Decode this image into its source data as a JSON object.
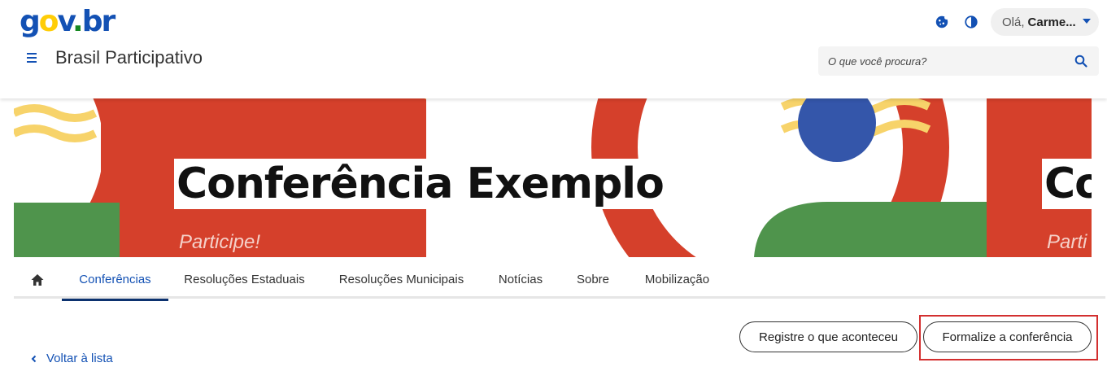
{
  "header": {
    "logo": {
      "g": "g",
      "o": "o",
      "v": "v",
      "dot": ".",
      "br": "br"
    },
    "cookie_icon": "cookie-icon",
    "contrast_icon": "contrast-icon",
    "user": {
      "greeting": "Olá,",
      "name": "Carme..."
    },
    "menu_icon": "hamburger-menu-icon",
    "site_title": "Brasil Participativo",
    "search": {
      "placeholder": "O que você procura?",
      "value": "",
      "icon": "search-icon"
    }
  },
  "banner": {
    "title": "Conferência Exemplo",
    "title_repeat": "Co",
    "subtitle": "Participe!",
    "subtitle_repeat": "Parti"
  },
  "tabs": [
    {
      "label": "",
      "icon": "home-icon",
      "active": false
    },
    {
      "label": "Conferências",
      "active": true
    },
    {
      "label": "Resoluções Estaduais",
      "active": false
    },
    {
      "label": "Resoluções Municipais",
      "active": false
    },
    {
      "label": "Notícias",
      "active": false
    },
    {
      "label": "Sobre",
      "active": false
    },
    {
      "label": "Mobilização",
      "active": false
    }
  ],
  "actions": {
    "register_label": "Registre o que aconteceu",
    "formalize_label": "Formalize a conferência"
  },
  "back_link": {
    "label": "Voltar à lista",
    "icon": "chevron-left-icon"
  },
  "colors": {
    "primary_blue": "#1351b4",
    "active_tab_underline": "#0c326f",
    "banner_red": "#d5402b",
    "banner_yellow": "#f7d36a",
    "banner_green": "#4f944c",
    "banner_blue": "#3456aa",
    "highlight_red": "#d32f2f"
  }
}
